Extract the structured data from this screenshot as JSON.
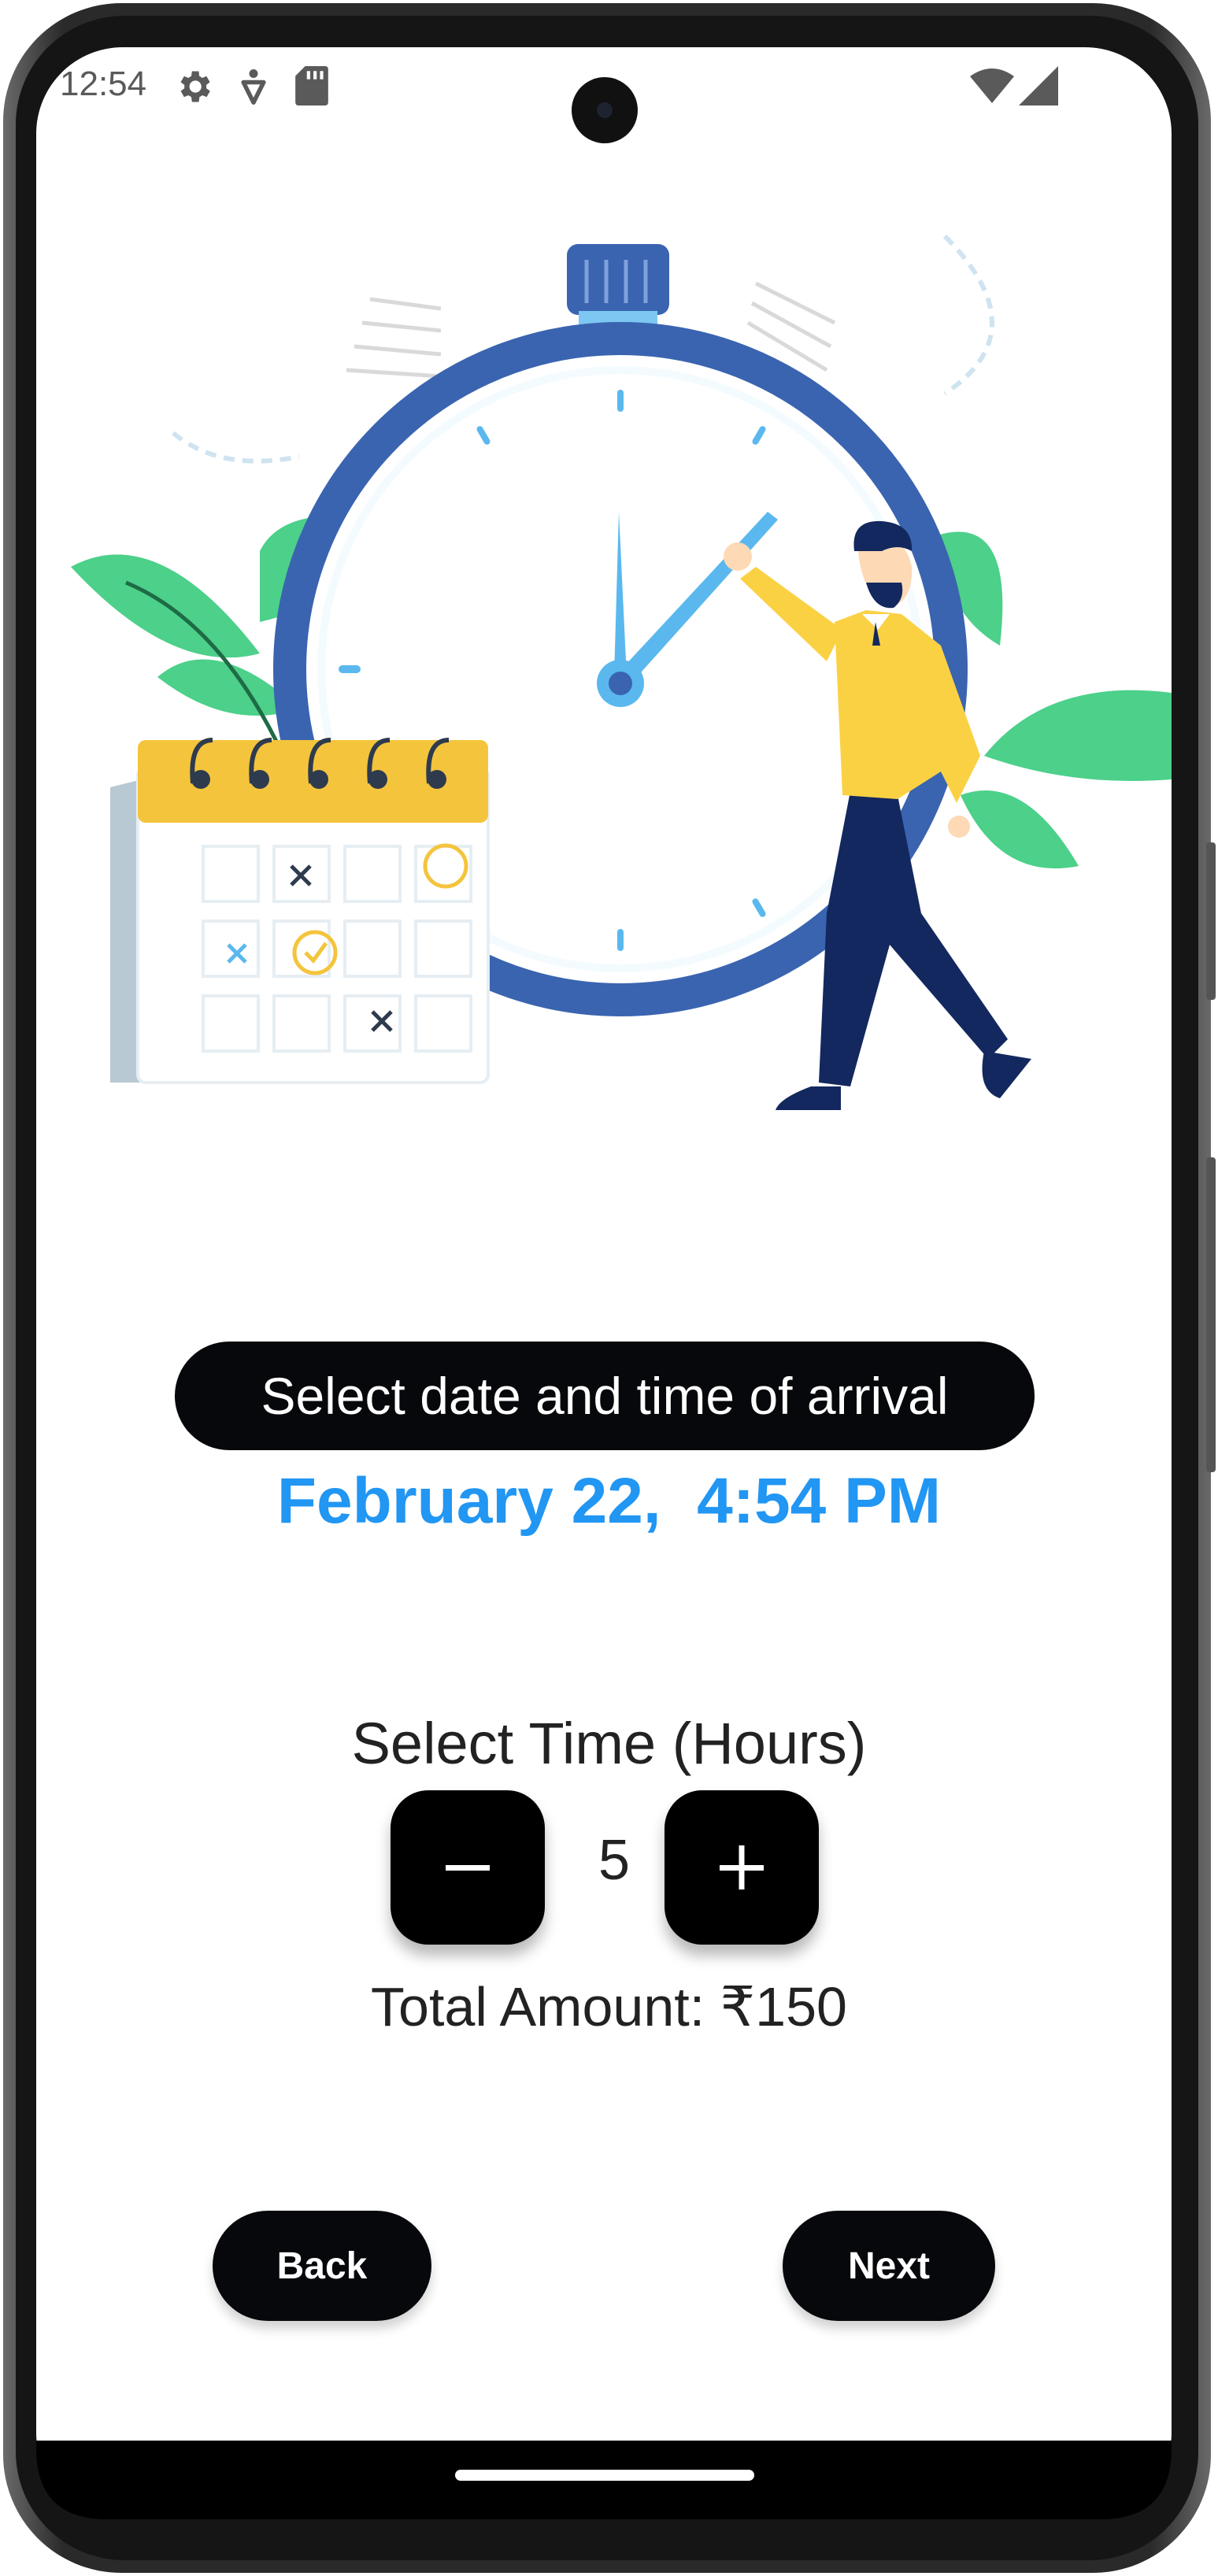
{
  "status_bar": {
    "time": "12:54",
    "icons": [
      "gear-icon",
      "accessibility-icon",
      "sd-card-icon",
      "wifi-icon",
      "cellular-signal-icon"
    ]
  },
  "illustration": {
    "subject": "stopwatch-calendar-illustration"
  },
  "main": {
    "prompt_label": "Select date and time of arrival",
    "selected_datetime": "February 22,  4:54 PM",
    "hours_label": "Select Time (Hours)",
    "hours_value": "5",
    "total_amount": "Total Amount: ₹150"
  },
  "stepper": {
    "decrement_icon": "minus-icon",
    "increment_icon": "plus-icon"
  },
  "footer": {
    "back_label": "Back",
    "next_label": "Next"
  },
  "colors": {
    "accent": "#2196f3",
    "button_bg": "#07080b",
    "clock_blue": "#3a64b0",
    "leaf_green": "#4cd08a",
    "shirt_yellow": "#fbd144"
  }
}
